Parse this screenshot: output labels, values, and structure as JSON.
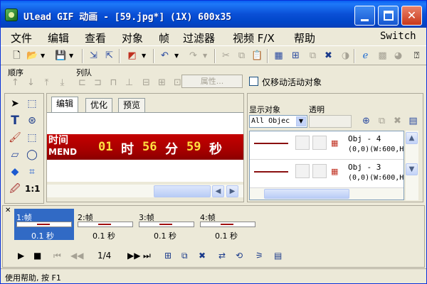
{
  "window": {
    "title": "Ulead GIF 动画 - [59.jpg*] (1X) 600x35",
    "min_label": "minimize",
    "max_label": "maximize",
    "close_label": "close"
  },
  "menu": [
    "文件",
    "编辑",
    "查看",
    "对象",
    "帧",
    "过滤器",
    "视频 F/X",
    "帮助"
  ],
  "menu_switch": "Switch",
  "toolbar_icons": [
    "new-icon",
    "open-icon",
    "save-icon",
    "import-icon",
    "export-icon",
    "color-icon",
    "undo-icon",
    "redo-icon",
    "cut-icon",
    "copy-icon",
    "paste-icon",
    "frame-icon",
    "delete-icon",
    "optimize-icon",
    "browser-preview-icon",
    "help-icon"
  ],
  "sequence": {
    "order_label": "顺序",
    "queue_label": "列队",
    "properties_button": "属性...",
    "move_active_only_label": "仅移动活动对象"
  },
  "editor": {
    "tabs": [
      "编辑",
      "优化",
      "预览"
    ],
    "active_tab": 0,
    "banner": {
      "left_top": "时间",
      "left_bottom": "MEND",
      "hours": "01",
      "hour_char": "时",
      "minutes": "56",
      "minute_char": "分",
      "seconds": "59",
      "second_char": "秒"
    }
  },
  "objects": {
    "show_label": "显示对象",
    "show_value": "All Objec",
    "opacity_label": "透明",
    "items": [
      {
        "name": "Obj - 4",
        "geom": "(0,0)(W:600,H"
      },
      {
        "name": "Obj - 3",
        "geom": "(0,0)(W:600,H"
      }
    ]
  },
  "frames": {
    "items": [
      {
        "label": "1:帧",
        "delay": "0.1 秒"
      },
      {
        "label": "2:帧",
        "delay": "0.1 秒"
      },
      {
        "label": "3:帧",
        "delay": "0.1 秒"
      },
      {
        "label": "4:帧",
        "delay": "0.1 秒"
      }
    ],
    "active": 0,
    "counter": "1/4"
  },
  "status": "使用帮助, 按 F1"
}
